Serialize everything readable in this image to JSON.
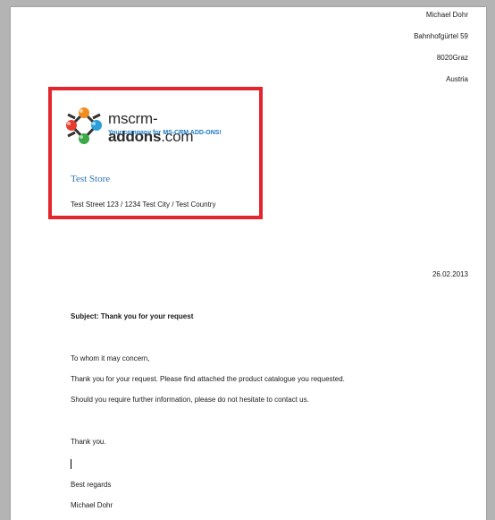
{
  "sender": {
    "name": "Michael Dohr",
    "street": "Bahnhofgürtel 59",
    "city": "8020Graz",
    "country": "Austria"
  },
  "logo": {
    "brand_light": "mscrm-",
    "brand_bold": "addons",
    "brand_suffix": ".com",
    "tagline": "Your company for MS-CRM ADD-ONS!"
  },
  "recipient": {
    "name": "Test Store",
    "address": "Test Street 123 / 1234 Test City / Test Country"
  },
  "date": "26.02.2013",
  "subject": "Subject: Thank you for your request",
  "body": {
    "salutation": "To whom it may concern,",
    "line1": "Thank you for your request. Please find attached the product catalogue you requested.",
    "line2": "Should you require further information, please do not hesitate to contact us.",
    "thanks": "Thank you.",
    "closing": "Best regards",
    "signature": "Michael Dohr"
  },
  "colors": {
    "highlight_border": "#e3262d",
    "store_name": "#2e75b6"
  }
}
